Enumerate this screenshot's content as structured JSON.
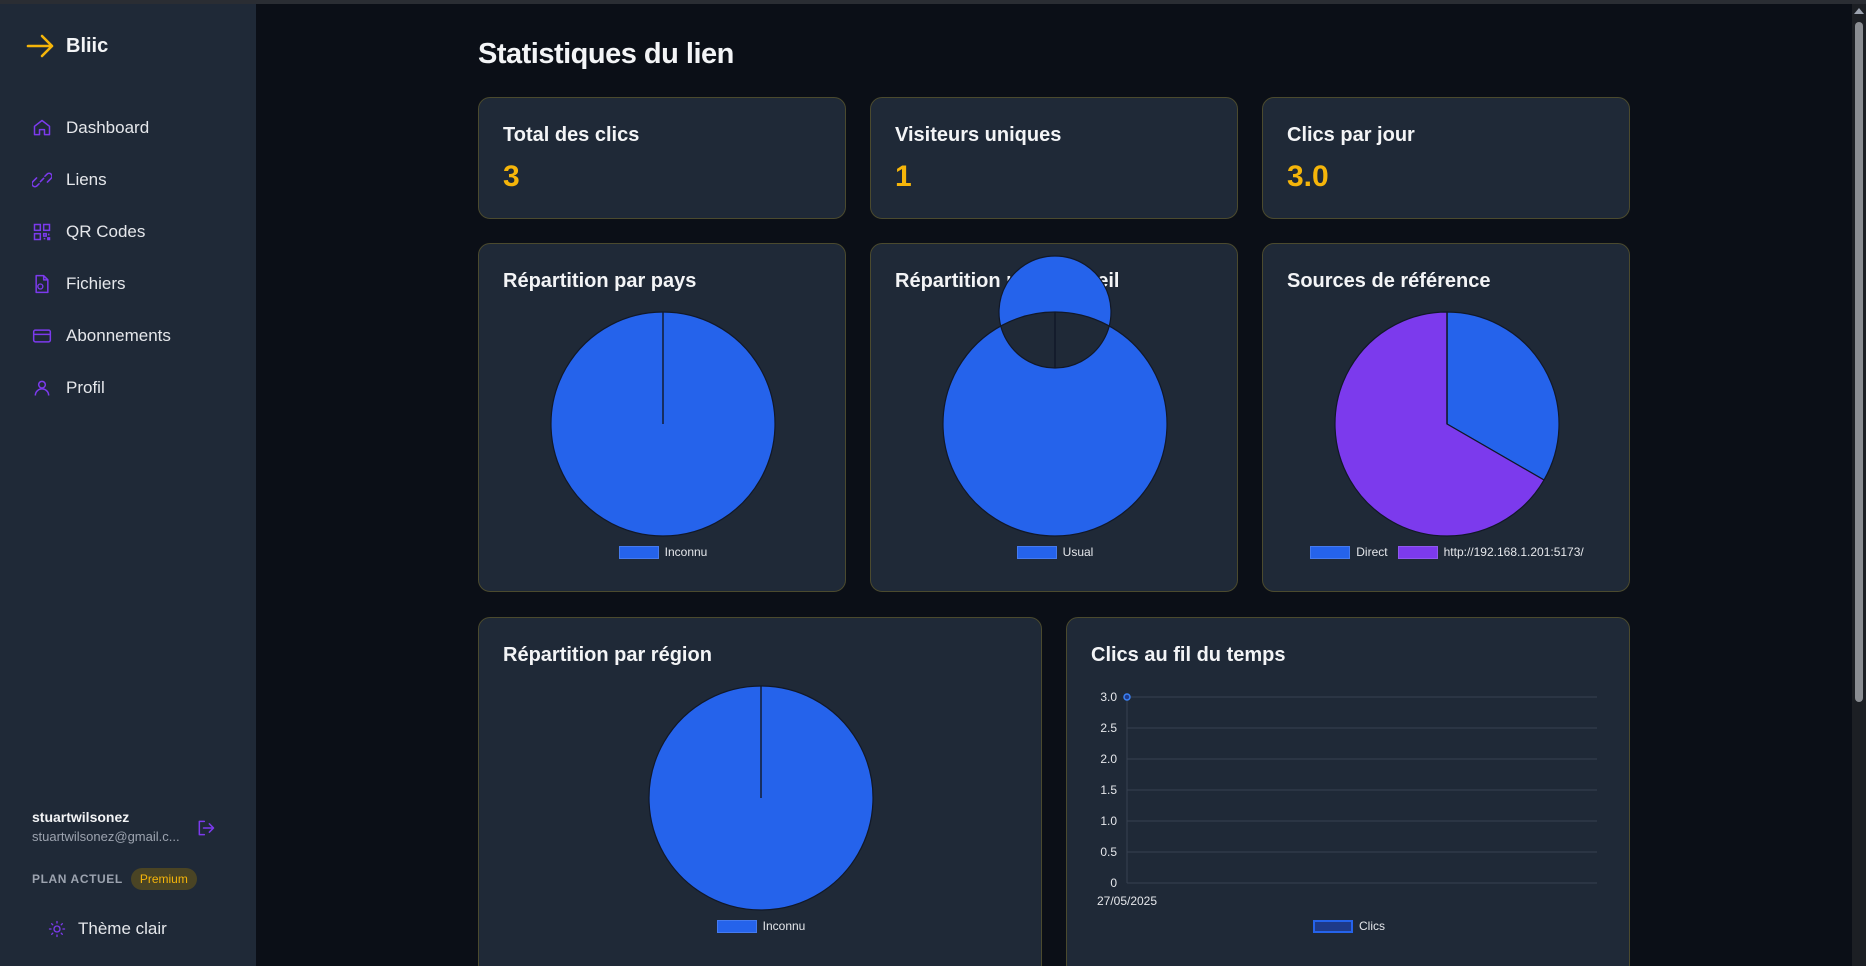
{
  "app": {
    "name": "Bliic"
  },
  "sidebar": {
    "items": [
      {
        "label": "Dashboard",
        "icon": "home-icon"
      },
      {
        "label": "Liens",
        "icon": "link-icon"
      },
      {
        "label": "QR Codes",
        "icon": "qr-code-icon"
      },
      {
        "label": "Fichiers",
        "icon": "file-icon"
      },
      {
        "label": "Abonnements",
        "icon": "credit-card-icon"
      },
      {
        "label": "Profil",
        "icon": "user-icon"
      }
    ],
    "user": {
      "name": "stuartwilsonez",
      "email": "stuartwilsonez@gmail.c..."
    },
    "plan_label": "PLAN ACTUEL",
    "plan_value": "Premium",
    "theme_label": "Thème clair"
  },
  "page": {
    "title": "Statistiques du lien",
    "stats": [
      {
        "label": "Total des clics",
        "value": "3"
      },
      {
        "label": "Visiteurs uniques",
        "value": "1"
      },
      {
        "label": "Clics par jour",
        "value": "3.0"
      }
    ]
  },
  "colors": {
    "accent": "#f5b50a",
    "blue": "#2563eb",
    "purple": "#7c3aed",
    "card": "#1f2937",
    "background": "#0b0f17"
  },
  "chart_data": [
    {
      "type": "pie",
      "title": "Répartition par pays",
      "labels": [
        "Inconnu"
      ],
      "values": [
        3
      ],
      "colors": [
        "#2563eb"
      ]
    },
    {
      "type": "doughnut",
      "title": "Répartition par appareil",
      "labels": [
        "Usual"
      ],
      "values": [
        3
      ],
      "colors": [
        "#2563eb"
      ]
    },
    {
      "type": "pie",
      "title": "Sources de référence",
      "labels": [
        "Direct",
        "http://192.168.1.201:5173/"
      ],
      "values": [
        1,
        2
      ],
      "colors": [
        "#2563eb",
        "#7c3aed"
      ]
    },
    {
      "type": "pie",
      "title": "Répartition par région",
      "labels": [
        "Inconnu"
      ],
      "values": [
        3
      ],
      "colors": [
        "#2563eb"
      ]
    },
    {
      "type": "line",
      "title": "Clics au fil du temps",
      "x": [
        "27/05/2025"
      ],
      "series": [
        {
          "name": "Clics",
          "values": [
            3
          ]
        }
      ],
      "ylim": [
        0,
        3
      ],
      "yticks": [
        "0",
        "0.5",
        "1.0",
        "1.5",
        "2.0",
        "2.5",
        "3.0"
      ],
      "grid": true,
      "legend": "bottom"
    }
  ]
}
